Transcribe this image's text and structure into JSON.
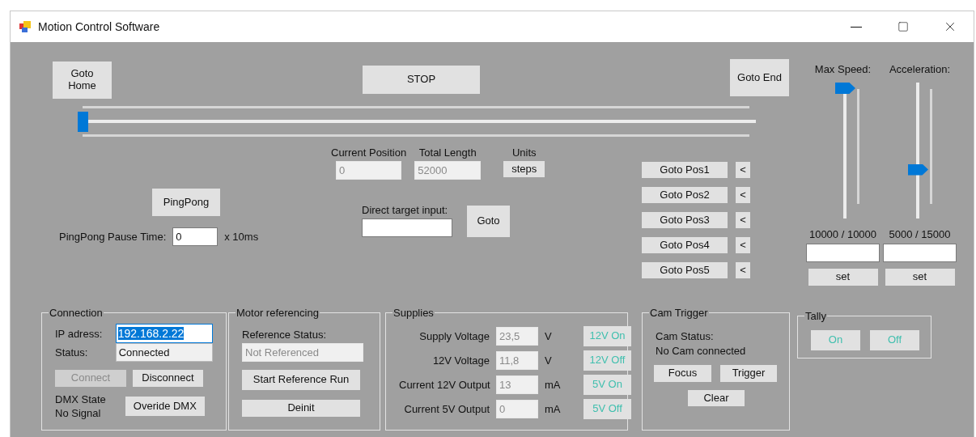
{
  "window": {
    "title": "Motion Control Software"
  },
  "top_buttons": {
    "home": "Goto\nHome",
    "stop": "STOP",
    "end": "Goto End"
  },
  "position_slider": {
    "level": 0
  },
  "position": {
    "current_label": "Current Position",
    "current_value": "0",
    "total_label": "Total Length",
    "total_value": "52000",
    "units_label": "Units",
    "units_button": "steps"
  },
  "pingpong": {
    "button": "PingPong",
    "pause_label": "PingPong Pause Time:",
    "pause_value": "0",
    "pause_unit": "x 10ms"
  },
  "direct_target": {
    "label": "Direct target input:",
    "button": "Goto"
  },
  "goto_positions": [
    {
      "label": "Goto Pos1",
      "set_button": "<"
    },
    {
      "label": "Goto Pos2",
      "set_button": "<"
    },
    {
      "label": "Goto Pos3",
      "set_button": "<"
    },
    {
      "label": "Goto Pos4",
      "set_button": "<"
    },
    {
      "label": "Goto Pos5",
      "set_button": "<"
    }
  ],
  "speed_sliders": [
    {
      "label": "Max Speed:",
      "level": 1,
      "reading": "10000 / 10000",
      "button": "set"
    },
    {
      "label": "Acceleration:",
      "level": 0.33,
      "reading": "5000 / 15000",
      "button": "set"
    }
  ],
  "connection": {
    "title": "Connection",
    "ip_label": "IP adress:",
    "ip_value": "192.168.2.22",
    "ip_text_selected": true,
    "status_label": "Status:",
    "status_value": "Connected",
    "buttons": [
      {
        "label": "Connect",
        "disabled": true
      },
      {
        "label": "Disconnect",
        "disabled": false
      }
    ],
    "dmx_label": "DMX State",
    "dmx_value": "No Signal",
    "override_button": "Overide DMX"
  },
  "motor_referencing": {
    "title": "Motor referencing",
    "status_label": "Reference Status:",
    "status_value": "Not Referenced",
    "start_button": "Start Reference Run",
    "deinit_button": "Deinit"
  },
  "supplies": {
    "title": "Supplies",
    "rows": [
      {
        "label": "Supply Voltage",
        "value": "23,5",
        "unit": "V",
        "button": "12V On"
      },
      {
        "label": "12V Voltage",
        "value": "11,8",
        "unit": "V",
        "button": "12V Off"
      },
      {
        "label": "Current 12V Output",
        "value": "13",
        "unit": "mA",
        "button": "5V On"
      },
      {
        "label": "Current 5V Output",
        "value": "0",
        "unit": "mA",
        "button": "5V Off"
      }
    ]
  },
  "cam_trigger": {
    "title": "Cam Trigger",
    "status_label": "Cam Status:",
    "status_value": "No Cam connected",
    "focus_button": "Focus",
    "trigger_button": "Trigger",
    "clear_button": "Clear"
  },
  "tally": {
    "title": "Tally",
    "buttons": [
      "On",
      "Off"
    ]
  }
}
